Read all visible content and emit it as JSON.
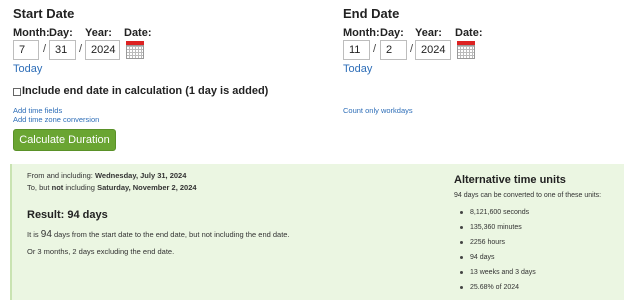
{
  "start": {
    "heading": "Start Date",
    "labels": {
      "month": "Month:",
      "day": "Day:",
      "year": "Year:",
      "date": "Date:"
    },
    "month": "7",
    "day": "31",
    "year": "2024",
    "today_link": "Today"
  },
  "end": {
    "heading": "End Date",
    "labels": {
      "month": "Month:",
      "day": "Day:",
      "year": "Year:",
      "date": "Date:"
    },
    "month": "11",
    "day": "2",
    "year": "2024",
    "today_link": "Today"
  },
  "separator": "/",
  "include_end_label": "Include end date in calculation (1 day is added)",
  "links": {
    "add_time_fields": "Add time fields",
    "add_time_zone": "Add time zone conversion",
    "count_workdays": "Count only workdays"
  },
  "calculate_button": "Calculate Duration",
  "result": {
    "from_prefix": "From and including: ",
    "from_date": "Wednesday, July 31, 2024",
    "to_prefix": "To, but ",
    "to_not": "not",
    "to_middle": " including ",
    "to_date": "Saturday, November 2, 2024",
    "title": "Result: 94 days",
    "line1_pre": "It is ",
    "line1_num": "94",
    "line1_post": " days from the start date to the end date, but not including the end date.",
    "line2": "Or 3 months, 2 days excluding the end date."
  },
  "alternative": {
    "title": "Alternative time units",
    "intro": "94 days can be converted to one of these units:",
    "items": [
      "8,121,600 seconds",
      "135,360 minutes",
      "2256 hours",
      "94 days",
      "13 weeks and 3 days",
      "25.68% of 2024"
    ]
  },
  "colors": {
    "link": "#2e6eb8",
    "button": "#6aa532",
    "result_bg": "#ebf6e2",
    "calendar_accent": "#dd2222"
  }
}
